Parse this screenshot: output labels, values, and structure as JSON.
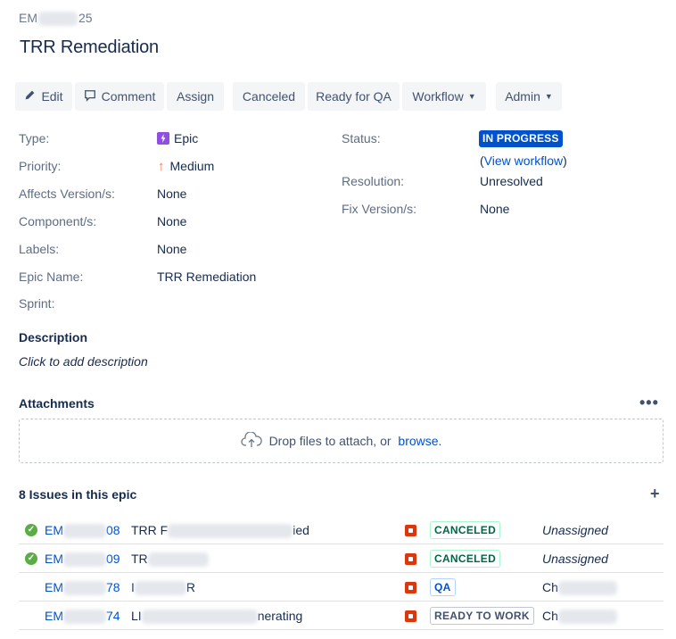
{
  "issue": {
    "key_prefix": "EM",
    "key_suffix": "25",
    "summary": "TRR Remediation"
  },
  "toolbar": {
    "edit": "Edit",
    "comment": "Comment",
    "assign": "Assign",
    "canceled": "Canceled",
    "ready_for_qa": "Ready for QA",
    "workflow": "Workflow",
    "admin": "Admin"
  },
  "details": {
    "type_label": "Type:",
    "type_value": "Epic",
    "priority_label": "Priority:",
    "priority_value": "Medium",
    "affects_label": "Affects Version/s:",
    "affects_value": "None",
    "component_label": "Component/s:",
    "component_value": "None",
    "labels_label": "Labels:",
    "labels_value": "None",
    "epic_name_label": "Epic Name:",
    "epic_name_value": "TRR Remediation",
    "sprint_label": "Sprint:",
    "status_label": "Status:",
    "status_value": "IN PROGRESS",
    "view_workflow_open": "(",
    "view_workflow": "View workflow",
    "view_workflow_close": ")",
    "resolution_label": "Resolution:",
    "resolution_value": "Unresolved",
    "fix_label": "Fix Version/s:",
    "fix_value": "None"
  },
  "description": {
    "title": "Description",
    "placeholder": "Click to add description"
  },
  "attachments": {
    "title": "Attachments",
    "drop_text": "Drop files to attach, or ",
    "browse": "browse."
  },
  "epic_issues": {
    "title": "8 Issues in this epic",
    "rows": [
      {
        "key_prefix": "EM",
        "key_suffix": "08",
        "summary_start": "TRR F",
        "summary_end": "ied",
        "status": "CANCELED",
        "assignee": "Unassigned",
        "done": true
      },
      {
        "key_prefix": "EM",
        "key_suffix": "09",
        "summary_start": "TR",
        "summary_end": "",
        "status": "CANCELED",
        "assignee": "Unassigned",
        "done": true
      },
      {
        "key_prefix": "EM",
        "key_suffix": "78",
        "summary_start": "I",
        "summary_end": "R",
        "status": "QA",
        "assignee": "Ch",
        "done": false
      },
      {
        "key_prefix": "EM",
        "key_suffix": "74",
        "summary_start": "LI",
        "summary_end": "nerating",
        "status": "READY TO WORK",
        "assignee": "Ch",
        "done": false
      }
    ]
  },
  "colors": {
    "status_in_progress": "#0052cc",
    "link": "#0052cc",
    "epic": "#904ee2",
    "priority_medium": "#ff7452",
    "priority_block": "#de350b",
    "done": "#5aac44"
  },
  "icons": [
    "pencil-icon",
    "comment-icon",
    "chevron-down-icon",
    "epic-icon",
    "priority-medium-icon",
    "upload-cloud-icon",
    "more-icon",
    "plus-icon",
    "done-check-icon",
    "priority-block-icon"
  ]
}
